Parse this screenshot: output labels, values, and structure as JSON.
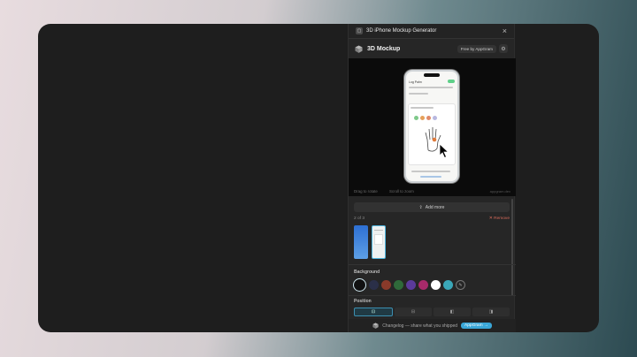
{
  "titlebar": {
    "title": "3D iPhone Mockup Generator",
    "icon": "app-icon",
    "close": "×"
  },
  "header": {
    "title": "3D Mockup",
    "free_label": "Free by AppGram",
    "settings_icon": "gear-icon"
  },
  "preview": {
    "hint_left": "Drag to rotate",
    "hint_right": "Scroll to zoom",
    "watermark": "appgram.dev",
    "phone_screen": {
      "heading": "Log Palm",
      "dot_colors": [
        "#7ec98a",
        "#e5a05a",
        "#e08a6a",
        "#b8b8e0"
      ]
    }
  },
  "actions": {
    "add_more_label": "Add more",
    "count_label": "2 of 3",
    "remove_label": "Remove"
  },
  "background": {
    "label": "Background",
    "swatches": [
      "#111111",
      "#2a2f48",
      "#8a3a2a",
      "#2f6a3a",
      "#5b3a9a",
      "#a82a6a",
      "#ffffff",
      "#3aa7b8"
    ],
    "selected": "#111111"
  },
  "position": {
    "label": "Position",
    "options": [
      "⊡",
      "⊟",
      "◧",
      "◨"
    ],
    "active_index": 0
  },
  "footer": {
    "text": "Changelog — share what you shipped",
    "cta": "AppGram →"
  },
  "colors": {
    "accent": "#3aa7d8",
    "danger": "#d86a5a"
  }
}
